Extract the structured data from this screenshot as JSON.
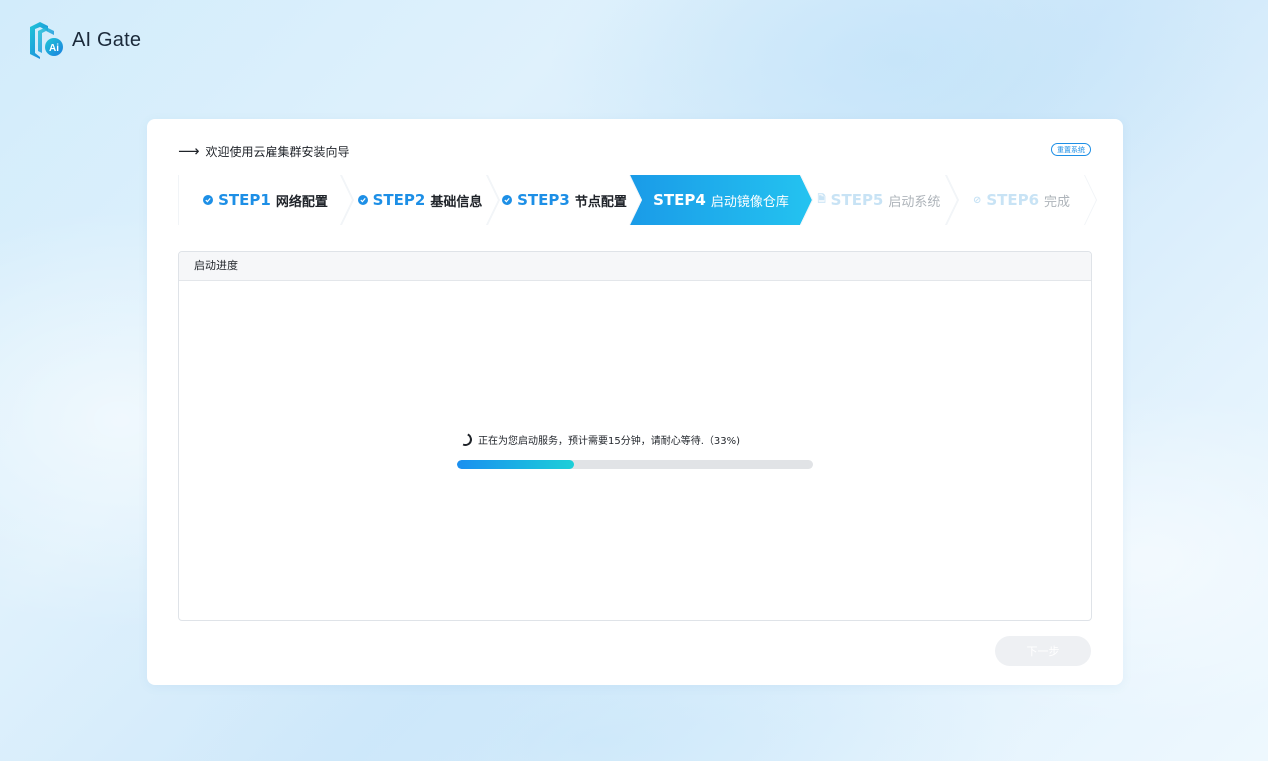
{
  "app": {
    "name": "AI Gate",
    "logo_mark": "Ai"
  },
  "welcome": {
    "arrow": "⟶",
    "text": "欢迎使用云雇集群安装向导"
  },
  "reset_button": "重置系统",
  "steps": [
    {
      "code": "STEP1",
      "label": "网络配置",
      "state": "done"
    },
    {
      "code": "STEP2",
      "label": "基础信息",
      "state": "done"
    },
    {
      "code": "STEP3",
      "label": "节点配置",
      "state": "done"
    },
    {
      "code": "STEP4",
      "label": "启动镜像仓库",
      "state": "active"
    },
    {
      "code": "STEP5",
      "label": "启动系统",
      "state": "pending"
    },
    {
      "code": "STEP6",
      "label": "完成",
      "state": "pending"
    }
  ],
  "panel": {
    "title": "启动进度",
    "status_text": "正在为您启动服务，预计需要15分钟，请耐心等待.（33%)",
    "progress": 0.33
  },
  "next_button": "下一步",
  "colors": {
    "accent": "#1d8fe6",
    "progress_start": "#1a8ff0",
    "progress_end": "#1ccfd8"
  }
}
